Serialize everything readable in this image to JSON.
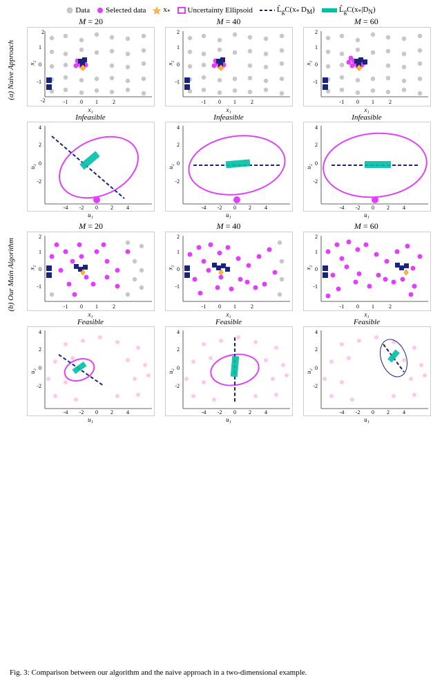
{
  "legend": {
    "items": [
      {
        "id": "data-dot",
        "label": "Data",
        "type": "dot",
        "color": "#c0c0c0"
      },
      {
        "id": "selected-data-dot",
        "label": "Selected data",
        "type": "dot",
        "color": "#e040fb"
      },
      {
        "id": "xstar-dot",
        "label": "x*",
        "type": "dot-star",
        "color": "#ffb74d"
      },
      {
        "id": "uncertainty-ellipsoid",
        "label": "Uncertainty Ellipsoid",
        "type": "square-outline",
        "color": "#e040fb"
      },
      {
        "id": "lgc-dm",
        "label": "L̂_g C(x* | D_M)",
        "type": "dashed",
        "color": "#1a1a6e"
      },
      {
        "id": "lgc-dn",
        "label": "L̂_g C(x* | D_N)",
        "type": "solid",
        "color": "#00bfa5"
      }
    ]
  },
  "section_a": {
    "label": "(a) Naive Approach",
    "m_values": [
      "M = 20",
      "M = 40",
      "M = 60"
    ],
    "status": "Infeasible"
  },
  "section_b": {
    "label": "(b) Our Main Algorithm",
    "m_values": [
      "M = 20",
      "M = 40",
      "M = 60"
    ],
    "status": "Feasible"
  },
  "axes": {
    "x1": "x₁",
    "x2": "x₂",
    "u1": "u₁",
    "u2": "u₂"
  },
  "caption": "Fig. 3: Comparison between our algorithm and the naive approach in a two-dimensional example."
}
